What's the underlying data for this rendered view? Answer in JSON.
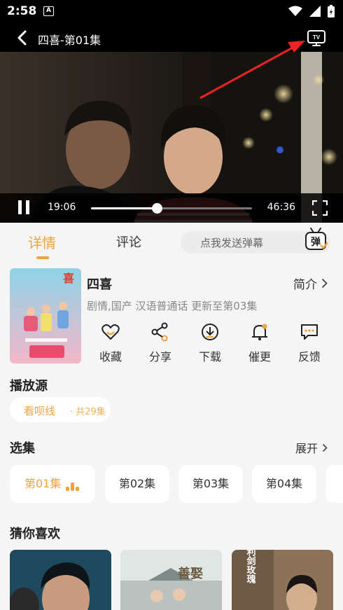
{
  "status": {
    "time": "2:58",
    "notif_letter": "A"
  },
  "player": {
    "title": "四喜-第01集",
    "current_time": "19:06",
    "total_time": "46:36",
    "progress": 0.41
  },
  "tabs": {
    "details": "详情",
    "comments": "评论"
  },
  "danmu": {
    "placeholder": "点我发送弹幕",
    "icon_char": "弹"
  },
  "show": {
    "title": "四喜",
    "intro": "简介",
    "meta": "剧情,国产 汉语普通话 更新至第03集",
    "poster_text": "喜"
  },
  "actions": [
    {
      "label": "收藏",
      "icon": "heart-icon"
    },
    {
      "label": "分享",
      "icon": "share-icon"
    },
    {
      "label": "下载",
      "icon": "download-icon"
    },
    {
      "label": "催更",
      "icon": "bell-icon"
    },
    {
      "label": "反馈",
      "icon": "feedback-icon"
    }
  ],
  "source": {
    "title": "播放源",
    "name": "看呗线",
    "count": "· 共29集"
  },
  "episodes": {
    "title": "选集",
    "expand": "展开",
    "items": [
      "第01集",
      "第02集",
      "第03集",
      "第04集"
    ]
  },
  "recommend": {
    "title": "猜你喜欢",
    "card2_text": "善娶",
    "card3_text": "利剑玫瑰"
  },
  "colors": {
    "accent": "#f2a23a",
    "annotation": "#ee2222"
  }
}
